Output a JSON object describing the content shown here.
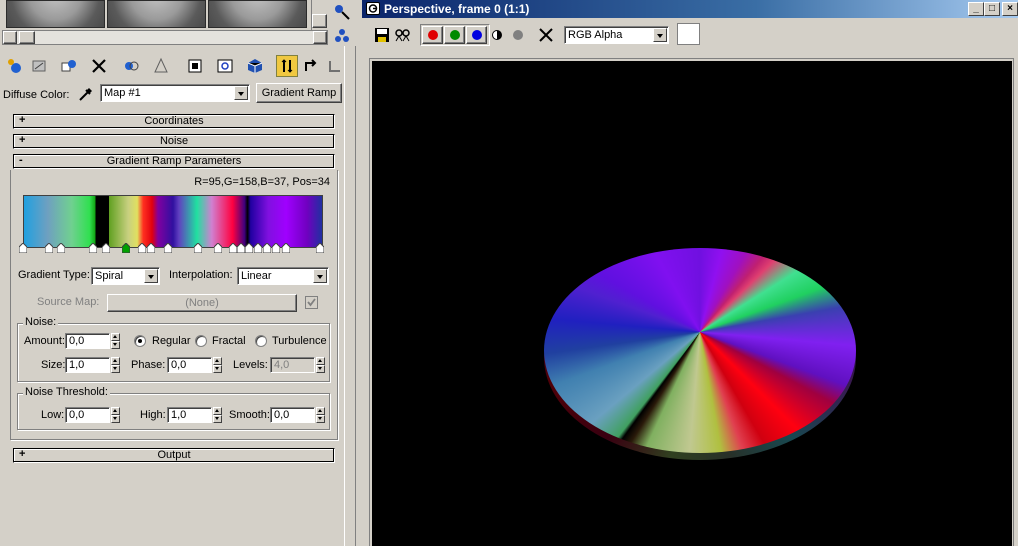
{
  "left_panel": {
    "diffuse_label": "Diffuse Color:",
    "map_value": "Map #1",
    "map_type_button": "Gradient Ramp",
    "rollouts": {
      "coordinates": "Coordinates",
      "noise": "Noise",
      "gradient_params": "Gradient Ramp Parameters",
      "output": "Output",
      "plus": "+",
      "minus": "-"
    },
    "ramp_readout": "R=95,G=158,B=37, Pos=34",
    "gradient_type_label": "Gradient Type:",
    "gradient_type_value": "Spiral",
    "interpolation_label": "Interpolation:",
    "interpolation_value": "Linear",
    "source_map_label": "Source Map:",
    "source_map_value": "(None)",
    "noise_group_label": "Noise:",
    "amount_label": "Amount:",
    "amount_value": "0,0",
    "regular_label": "Regular",
    "fractal_label": "Fractal",
    "turbulence_label": "Turbulence",
    "noise_mode_selected": "Regular",
    "size_label": "Size:",
    "size_value": "1,0",
    "phase_label": "Phase:",
    "phase_value": "0,0",
    "levels_label": "Levels:",
    "levels_value": "4,0",
    "threshold_group_label": "Noise Threshold:",
    "low_label": "Low:",
    "low_value": "0,0",
    "high_label": "High:",
    "high_value": "1,0",
    "smooth_label": "Smooth:",
    "smooth_value": "0,0"
  },
  "render_window": {
    "title": "Perspective, frame 0 (1:1)",
    "channel_value": "RGB Alpha",
    "colors": {
      "red": "#e00000",
      "green": "#008a00",
      "blue": "#0000e0",
      "titlebar": "#0a246a"
    }
  }
}
